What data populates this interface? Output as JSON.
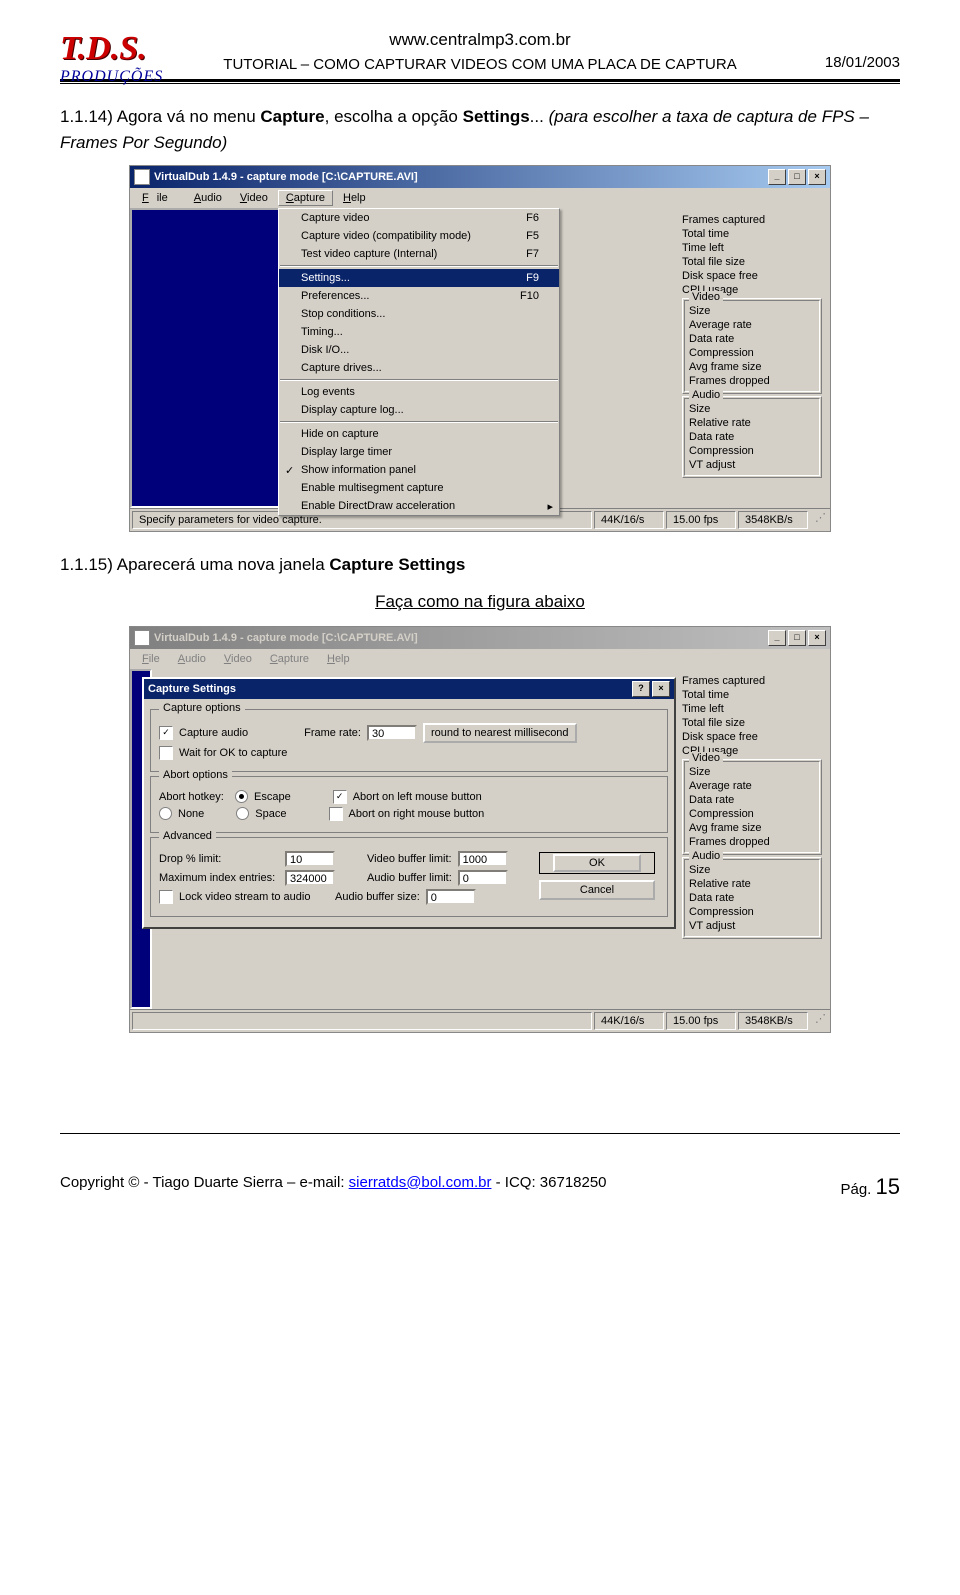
{
  "header": {
    "logo_main": "T.D.S.",
    "logo_sub": "PRODUÇÕES",
    "url": "www.centralmp3.com.br",
    "tutorial": "TUTORIAL – COMO CAPTURAR VIDEOS COM UMA PLACA DE CAPTURA",
    "date": "18/01/2003"
  },
  "step1": {
    "num": "1.1.14)",
    "text_a": "Agora vá no menu ",
    "bold_a": "Capture",
    "text_b": ", escolha a opção ",
    "bold_b": "Settings",
    "text_c": "... ",
    "italic": "(para escolher a taxa de captura de FPS – Frames Por Segundo)"
  },
  "screenshot1": {
    "title": "VirtualDub 1.4.9 - capture mode [C:\\CAPTURE.AVI]",
    "menubar": [
      "File",
      "Audio",
      "Video",
      "Capture",
      "Help"
    ],
    "menubar_underline": [
      0,
      0,
      0,
      0,
      0
    ],
    "open_menu_index": 3,
    "dropdown": [
      {
        "label": "Capture video",
        "shortcut": "F6"
      },
      {
        "label": "Capture video (compatibility mode)",
        "shortcut": "F5"
      },
      {
        "label": "Test video capture (Internal)",
        "shortcut": "F7"
      },
      {
        "sep": true
      },
      {
        "label": "Settings...",
        "shortcut": "F9",
        "selected": true
      },
      {
        "label": "Preferences...",
        "shortcut": "F10"
      },
      {
        "label": "Stop conditions..."
      },
      {
        "label": "Timing..."
      },
      {
        "label": "Disk I/O..."
      },
      {
        "label": "Capture drives..."
      },
      {
        "sep": true
      },
      {
        "label": "Log events"
      },
      {
        "label": "Display capture log..."
      },
      {
        "sep": true
      },
      {
        "label": "Hide on capture"
      },
      {
        "label": "Display large timer"
      },
      {
        "label": "Show information panel",
        "checked": true
      },
      {
        "label": "Enable multisegment capture"
      },
      {
        "label": "Enable DirectDraw acceleration",
        "submenu": true
      }
    ],
    "sidepanel": {
      "top": [
        "Frames captured",
        "Total time",
        "Time left",
        "Total file size",
        "Disk space free",
        "CPU usage"
      ],
      "video_title": "Video",
      "video": [
        "Size",
        "Average rate",
        "Data rate",
        "Compression",
        "Avg frame size",
        "Frames dropped"
      ],
      "audio_title": "Audio",
      "audio": [
        "Size",
        "Relative rate",
        "Data rate",
        "Compression",
        "VT adjust"
      ]
    },
    "status_main": "Specify parameters for video capture.",
    "status_cells": [
      "44K/16/s",
      "15.00 fps",
      "3548KB/s"
    ]
  },
  "step2": {
    "num": "1.1.15)",
    "text_a": "Aparecerá uma nova janela ",
    "bold_a": "Capture Settings",
    "caption": "Faça como na figura abaixo"
  },
  "screenshot2": {
    "title": "VirtualDub 1.4.9 - capture mode [C:\\CAPTURE.AVI]",
    "menubar": [
      "File",
      "Audio",
      "Video",
      "Capture",
      "Help"
    ],
    "dialog": {
      "title": "Capture Settings",
      "grp_capture": "Capture options",
      "capture_audio": "Capture audio",
      "wait_ok": "Wait for OK to capture",
      "frame_rate_label": "Frame rate:",
      "frame_rate_value": "30",
      "round_btn": "round to nearest millisecond",
      "grp_abort": "Abort options",
      "abort_hotkey": "Abort hotkey:",
      "escape": "Escape",
      "none": "None",
      "space": "Space",
      "abort_left": "Abort on left mouse button",
      "abort_right": "Abort on right mouse button",
      "grp_adv": "Advanced",
      "drop_limit": "Drop % limit:",
      "drop_limit_val": "10",
      "max_index": "Maximum index entries:",
      "max_index_val": "324000",
      "lock_video": "Lock video stream to audio",
      "video_buf": "Video buffer limit:",
      "video_buf_val": "1000",
      "audio_buf": "Audio buffer limit:",
      "audio_buf_val": "0",
      "audio_size": "Audio buffer size:",
      "audio_size_val": "0",
      "ok": "OK",
      "cancel": "Cancel"
    },
    "status_cells": [
      "44K/16/s",
      "15.00 fps",
      "3548KB/s"
    ]
  },
  "footer": {
    "copyright": "Copyright © - Tiago Duarte Sierra – e-mail: ",
    "email": "sierratds@bol.com.br",
    "icq": " - ICQ: 36718250",
    "page_label": "Pág.",
    "page_num": "15"
  }
}
